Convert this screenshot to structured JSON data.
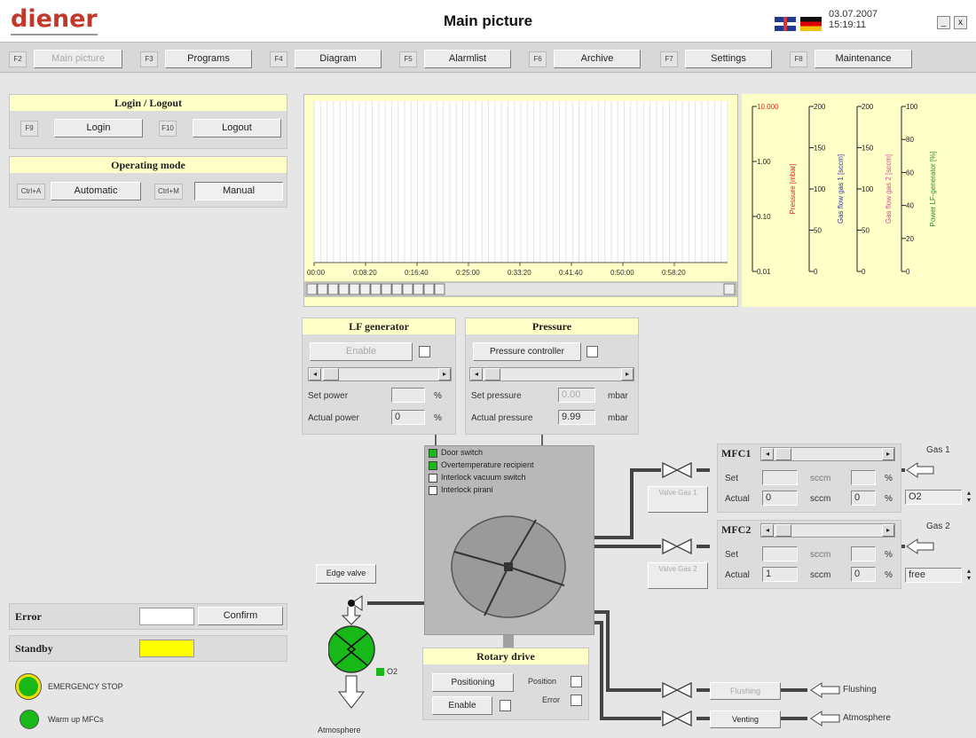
{
  "header": {
    "logo": "diener",
    "title": "Main picture",
    "date": "03.07.2007",
    "time": "15:19:11",
    "minimize": "_",
    "close": "x"
  },
  "fkeys": [
    {
      "key": "F2",
      "label": "Main picture",
      "disabled": true
    },
    {
      "key": "F3",
      "label": "Programs"
    },
    {
      "key": "F4",
      "label": "Diagram"
    },
    {
      "key": "F5",
      "label": "Alarmlist"
    },
    {
      "key": "F6",
      "label": "Archive"
    },
    {
      "key": "F7",
      "label": "Settings"
    },
    {
      "key": "F8",
      "label": "Maintenance"
    }
  ],
  "login": {
    "title": "Login / Logout",
    "f9": "F9",
    "login": "Login",
    "f10": "F10",
    "logout": "Logout"
  },
  "mode": {
    "title": "Operating mode",
    "k1": "Ctrl+A",
    "auto": "Automatic",
    "k2": "Ctrl+M",
    "manual": "Manual"
  },
  "chart_data": {
    "type": "line",
    "x_ticks": [
      "00:00",
      "0:08:20",
      "0:16:40",
      "0:25:00",
      "0:33:20",
      "0:41:40",
      "0:50:00",
      "0:58:20"
    ],
    "series": [],
    "axes": [
      {
        "label": "Pressure [mbar]",
        "color": "#e02020",
        "ticks": [
          "10.000",
          "1.00",
          "0.10",
          "0.01"
        ],
        "scale": "log"
      },
      {
        "label": "Gas flow gas 1 [sccm]",
        "color": "#3030c0",
        "ticks": [
          "200",
          "150",
          "100",
          "50",
          "0"
        ]
      },
      {
        "label": "Gas flow gas 2 [sccm]",
        "color": "#e040a0",
        "ticks": [
          "200",
          "150",
          "100",
          "50",
          "0"
        ]
      },
      {
        "label": "Power LF-generator [%]",
        "color": "#209020",
        "ticks": [
          "100",
          "80",
          "60",
          "40",
          "20",
          "0"
        ]
      }
    ],
    "grid": true
  },
  "lf": {
    "title": "LF generator",
    "enable": "Enable",
    "set_power": "Set power",
    "set_unit": "%",
    "act_power": "Actual power",
    "act_val": "0",
    "act_unit": "%"
  },
  "pressure": {
    "title": "Pressure",
    "controller": "Pressure controller",
    "set_label": "Set pressure",
    "set_val": "0.00",
    "set_unit": "mbar",
    "act_label": "Actual pressure",
    "act_val": "9.99",
    "act_unit": "mbar"
  },
  "interlocks": [
    "Door switch",
    "Overtemperature recipient",
    "Interlock vacuum switch",
    "Interlock pirani"
  ],
  "mfc1": {
    "title": "MFC1",
    "set": "Set",
    "act": "Actual",
    "act_val": "0",
    "unit": "sccm",
    "pct": "%",
    "pct_val": "0",
    "gas_label": "Gas 1",
    "gas": "O2",
    "valve_btn": "Valve Gas 1"
  },
  "mfc2": {
    "title": "MFC2",
    "set": "Set",
    "act": "Actual",
    "act_val": "1",
    "unit": "sccm",
    "pct": "%",
    "pct_val": "0",
    "gas_label": "Gas 2",
    "gas": "free",
    "valve_btn": "Valve Gas 2"
  },
  "edge_valve": "Edge valve",
  "pump_o2": "O2",
  "atmosphere_bottom": "Atmosphere",
  "rotary": {
    "title": "Rotary drive",
    "positioning": "Positioning",
    "enable": "Enable",
    "position": "Position",
    "error": "Error"
  },
  "flushing": {
    "btn": "Flushing",
    "label": "Flushing"
  },
  "venting": {
    "btn": "Venting",
    "label": "Atmosphere"
  },
  "status": {
    "error": "Error",
    "confirm": "Confirm",
    "standby": "Standby",
    "estop": "EMERGENCY STOP",
    "warmup": "Warm up MFCs"
  },
  "colors": {
    "green": "#18b818",
    "yellow": "#ffff00",
    "chart_bg": "#ffffc8"
  }
}
